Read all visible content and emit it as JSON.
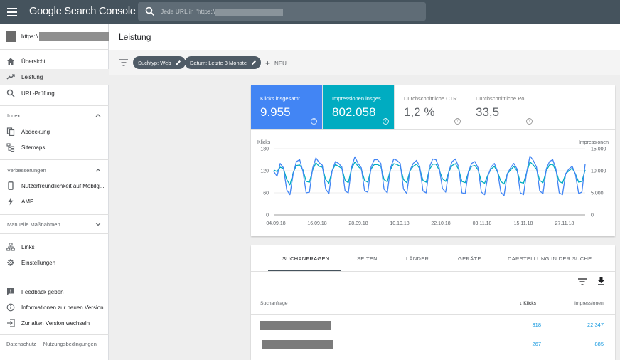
{
  "app": {
    "title": "Google Search Console"
  },
  "search": {
    "placeholder": "Jede URL in \"https://"
  },
  "property": {
    "prefix": "https://"
  },
  "sidebar": {
    "items": [
      {
        "label": "Übersicht",
        "icon": "home-icon"
      },
      {
        "label": "Leistung",
        "icon": "trending-up-icon"
      },
      {
        "label": "URL-Prüfung",
        "icon": "search-icon"
      }
    ],
    "index_header": "Index",
    "index_items": [
      {
        "label": "Abdeckung",
        "icon": "copy-icon"
      },
      {
        "label": "Sitemaps",
        "icon": "sitemap-icon"
      }
    ],
    "improvements_header": "Verbesserungen",
    "improvements_items": [
      {
        "label": "Nutzerfreundlichkeit auf Mobilg...",
        "icon": "phone-icon"
      },
      {
        "label": "AMP",
        "icon": "bolt-icon"
      }
    ],
    "manual_header": "Manuelle Maßnahmen",
    "bottom_items": [
      {
        "label": "Links",
        "icon": "links-icon"
      },
      {
        "label": "Einstellungen",
        "icon": "gear-icon"
      }
    ],
    "extra_items": [
      {
        "label": "Feedback geben",
        "icon": "feedback-icon"
      },
      {
        "label": "Informationen zur neuen Version",
        "icon": "info-icon"
      },
      {
        "label": "Zur alten Version wechseln",
        "icon": "exit-icon"
      }
    ],
    "footer": [
      "Datenschutz",
      "Nutzungsbedingungen"
    ]
  },
  "header": {
    "title": "Leistung"
  },
  "filters": {
    "chips": [
      "Suchtyp: Web",
      "Datum: Letzte 3 Monate"
    ],
    "new_label": "NEU"
  },
  "metrics": [
    {
      "label": "Klicks insgesamt",
      "value": "9.955"
    },
    {
      "label": "Impressionen insges...",
      "value": "802.058"
    },
    {
      "label": "Durchschnittliche CTR",
      "value": "1,2 %"
    },
    {
      "label": "Durchschnittliche Po...",
      "value": "33,5"
    }
  ],
  "colors": {
    "clicks": "#4285f4",
    "impressions": "#00acc1",
    "topbar": "#45535d"
  },
  "chart_data": {
    "type": "line",
    "left_axis_label": "Klicks",
    "right_axis_label": "Impressionen",
    "left_ticks": [
      "180",
      "120",
      "60",
      "0"
    ],
    "right_ticks": [
      "15.000",
      "10.000",
      "5.000",
      "0"
    ],
    "ylim_left": [
      0,
      180
    ],
    "ylim_right": [
      0,
      15000
    ],
    "x_tick_labels": [
      "04.09.18",
      "16.09.18",
      "28.09.18",
      "10.10.18",
      "22.10.18",
      "03.11.18",
      "15.11.18",
      "27.11.18"
    ],
    "series": [
      {
        "name": "Klicks",
        "axis": "left",
        "values": [
          118,
          105,
          140,
          128,
          68,
          55,
          112,
          145,
          150,
          118,
          60,
          62,
          128,
          155,
          142,
          135,
          70,
          58,
          120,
          145,
          140,
          130,
          65,
          60,
          130,
          158,
          140,
          128,
          65,
          62,
          130,
          150,
          150,
          140,
          70,
          60,
          128,
          152,
          148,
          140,
          70,
          58,
          122,
          140,
          148,
          132,
          65,
          60,
          130,
          152,
          150,
          128,
          72,
          62,
          120,
          145,
          152,
          130,
          60,
          58,
          118,
          140,
          145,
          128,
          62,
          55,
          105,
          130,
          140,
          118,
          62,
          52,
          112,
          128,
          140,
          125,
          60,
          55,
          118,
          160,
          148,
          130,
          65,
          58,
          125,
          145,
          150,
          125,
          60,
          55,
          112,
          125,
          132,
          110,
          58,
          62,
          138
        ]
      },
      {
        "name": "Impressionen",
        "axis": "right",
        "values": [
          10200,
          9800,
          10800,
          10500,
          8000,
          6800,
          9600,
          11200,
          11300,
          10200,
          7600,
          7400,
          10200,
          11800,
          11000,
          10800,
          8000,
          7200,
          10000,
          11400,
          11000,
          10500,
          7800,
          7300,
          10500,
          12000,
          11000,
          10300,
          7800,
          7400,
          10400,
          11400,
          11400,
          11000,
          8000,
          7500,
          10300,
          11600,
          11400,
          11000,
          8000,
          7300,
          10000,
          11000,
          11500,
          10500,
          7800,
          7400,
          10300,
          11500,
          11500,
          10200,
          8200,
          7600,
          9800,
          11200,
          11600,
          10300,
          7600,
          7300,
          9600,
          11000,
          11200,
          10200,
          7600,
          7200,
          9000,
          10400,
          11000,
          9700,
          7600,
          7000,
          9300,
          10200,
          11000,
          10000,
          7400,
          7200,
          9700,
          12000,
          11300,
          10300,
          7800,
          7300,
          10000,
          11300,
          11500,
          10000,
          7600,
          7200,
          9300,
          10000,
          10600,
          9300,
          7400,
          7600,
          10200
        ]
      }
    ]
  },
  "table": {
    "tabs": [
      "SUCHANFRAGEN",
      "SEITEN",
      "LÄNDER",
      "GERÄTE",
      "DARSTELLUNG IN DER SUCHE"
    ],
    "columns": [
      "Suchanfrage",
      "Klicks",
      "Impressionen"
    ],
    "rows": [
      {
        "clicks": "318",
        "impressions": "22.347"
      },
      {
        "clicks": "267",
        "impressions": "885"
      }
    ]
  }
}
